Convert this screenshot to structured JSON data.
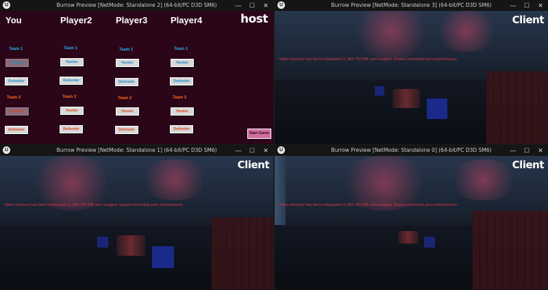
{
  "windows": [
    {
      "title": "Burrow Preview [NetMode: Standalone 2]  (64-bit/PC D3D SM6)"
    },
    {
      "title": "Burrow Preview [NetMode: Standalone 3]  (64-bit/PC D3D SM6)"
    },
    {
      "title": "Burrow Preview [NetMode: Standalone 1]  (64-bit/PC D3D SM6)"
    },
    {
      "title": "Burrow Preview [NetMode: Standalone 0]  (64-bit/PC D3D SM6)"
    }
  ],
  "controls": {
    "min": "—",
    "max": "☐",
    "close": "✕",
    "logo": "U"
  },
  "lobby": {
    "host_label": "host",
    "players": [
      "You",
      "Player2",
      "Player3",
      "Player4"
    ],
    "team1_label": "Team 1",
    "team2_label": "Team 2",
    "hunter_label": "Hunter",
    "defender_label": "Defender",
    "start_label": "Start Game"
  },
  "client_label": "Client",
  "warning": "Video memory has been exhausted (1 383.750 MB over budget). Expect extremely poor performance.",
  "colors": {
    "lobby_bg": "#2b0518",
    "team1": "#2ab0f0",
    "team2": "#ff6a1a",
    "warning": "#e0384a"
  }
}
